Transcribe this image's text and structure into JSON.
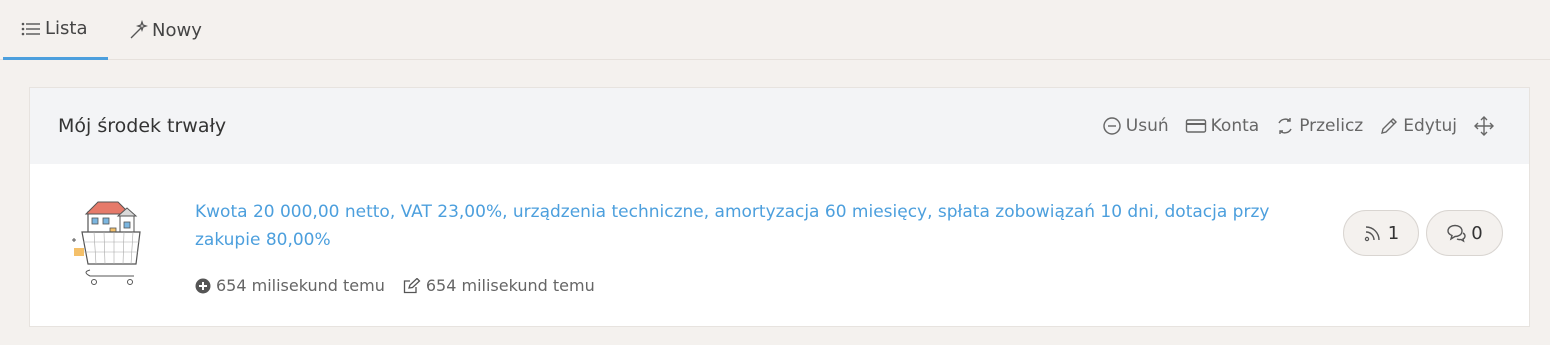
{
  "tabs": [
    {
      "label": "Lista",
      "icon": "list-icon",
      "active": true
    },
    {
      "label": "Nowy",
      "icon": "magic-wand-icon",
      "active": false
    }
  ],
  "card": {
    "title": "Mój środek trwały",
    "actions": [
      {
        "label": "Usuń",
        "icon": "minus-circle-icon"
      },
      {
        "label": "Konta",
        "icon": "credit-card-icon"
      },
      {
        "label": "Przelicz",
        "icon": "refresh-icon"
      },
      {
        "label": "Edytuj",
        "icon": "pencil-icon"
      },
      {
        "label": "",
        "icon": "move-arrows-icon"
      }
    ],
    "item": {
      "description": "Kwota 20 000,00 netto, VAT 23,00%, urządzenia techniczne, amortyzacja 60 miesięcy, spłata zobowiązań 10 dni, dotacja przy zakupie 80,00%",
      "created": "654 milisekund temu",
      "edited": "654 milisekund temu",
      "feed_count": "1",
      "comment_count": "0"
    }
  },
  "colors": {
    "accent": "#4c9fdd",
    "background": "#f4f1ee",
    "card_header": "#f3f4f6"
  }
}
